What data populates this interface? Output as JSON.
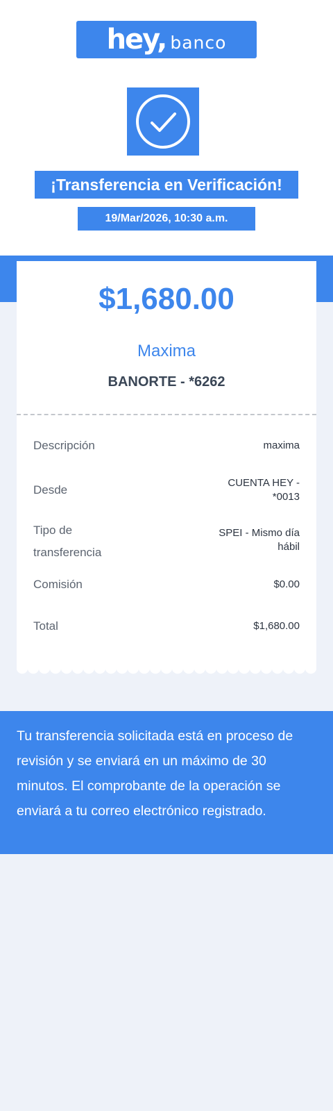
{
  "brand": {
    "name": "hey,",
    "suffix": "banco",
    "color": "#3d86ec"
  },
  "status": {
    "icon": "check-circle-icon",
    "title": "¡Transferencia en Verificación!",
    "datetime": "19/Mar/2026, 10:30 a.m."
  },
  "receipt": {
    "amount": "$1,680.00",
    "recipient_name": "Maxima",
    "recipient_bank": "BANORTE - *6262",
    "rows": [
      {
        "label": "Descripción",
        "value": "maxima"
      },
      {
        "label": "Desde",
        "value": "CUENTA HEY - *0013"
      },
      {
        "label": "Tipo de transferencia",
        "value": "SPEI - Mismo día hábil"
      },
      {
        "label": "Comisión",
        "value": "$0.00"
      },
      {
        "label": "Total",
        "value": "$1,680.00"
      }
    ]
  },
  "notice": {
    "text": "Tu transferencia solicitada está en proceso de revisión y se enviará en un máximo de 30 minutos. El comprobante de la operación se enviará a tu correo electrónico registrado."
  }
}
